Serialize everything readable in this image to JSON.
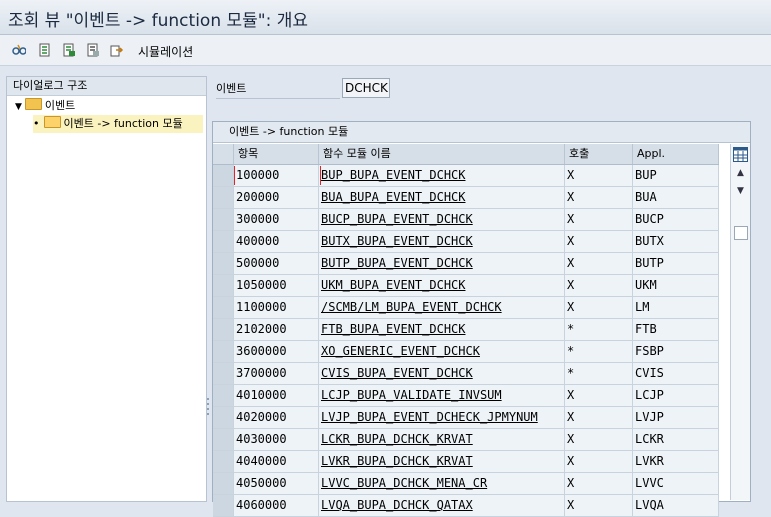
{
  "window": {
    "title": "조회 뷰 \"이벤트 -> function 모듈\": 개요"
  },
  "toolbar": {
    "icons": [
      "glasses-icon",
      "details-icon",
      "select-all-icon",
      "deselect-icon",
      "export-icon"
    ],
    "simulation_label": "시뮬레이션"
  },
  "tree": {
    "header": "다이얼로그 구조",
    "items": [
      {
        "label": "이벤트",
        "icon": "folder-icon"
      },
      {
        "label": "이벤트 -> function 모듈",
        "icon": "open-folder-icon"
      }
    ]
  },
  "event_field": {
    "label": "이벤트",
    "value": "DCHCK"
  },
  "table": {
    "title": "이벤트 -> function 모듈",
    "columns": [
      "항목",
      "함수 모듈 이름",
      "호출",
      "Appl."
    ],
    "rows": [
      [
        "100000",
        "BUP_BUPA_EVENT_DCHCK",
        "X",
        "BUP"
      ],
      [
        "200000",
        "BUA_BUPA_EVENT_DCHCK",
        "X",
        "BUA"
      ],
      [
        "300000",
        "BUCP_BUPA_EVENT_DCHCK",
        "X",
        "BUCP"
      ],
      [
        "400000",
        "BUTX_BUPA_EVENT_DCHCK",
        "X",
        "BUTX"
      ],
      [
        "500000",
        "BUTP_BUPA_EVENT_DCHCK",
        "X",
        "BUTP"
      ],
      [
        "1050000",
        "UKM_BUPA_EVENT_DCHCK",
        "X",
        "UKM"
      ],
      [
        "1100000",
        "/SCMB/LM_BUPA_EVENT_DCHCK",
        "X",
        "LM"
      ],
      [
        "2102000",
        "FTB_BUPA_EVENT_DCHCK",
        "*",
        "FTB"
      ],
      [
        "3600000",
        "XO_GENERIC_EVENT_DCHCK",
        "*",
        "FSBP"
      ],
      [
        "3700000",
        "CVIS_BUPA_EVENT_DCHCK",
        "*",
        "CVIS"
      ],
      [
        "4010000",
        "LCJP_BUPA_VALIDATE_INVSUM",
        "X",
        "LCJP"
      ],
      [
        "4020000",
        "LVJP_BUPA_EVENT_DCHECK_JPMYNUM",
        "X",
        "LVJP"
      ],
      [
        "4030000",
        "LCKR_BUPA_DCHCK_KRVAT",
        "X",
        "LCKR"
      ],
      [
        "4040000",
        "LVKR_BUPA_DCHCK_KRVAT",
        "X",
        "LVKR"
      ],
      [
        "4050000",
        "LVVC_BUPA_DCHCK_MENA_CR",
        "X",
        "LVVC"
      ],
      [
        "4060000",
        "LVQA_BUPA_DCHCK_QATAX",
        "X",
        "LVQA"
      ]
    ]
  },
  "colors": {
    "accent": "#f3c350",
    "selection": "#fbf3bf",
    "focus": "#e0242a"
  }
}
